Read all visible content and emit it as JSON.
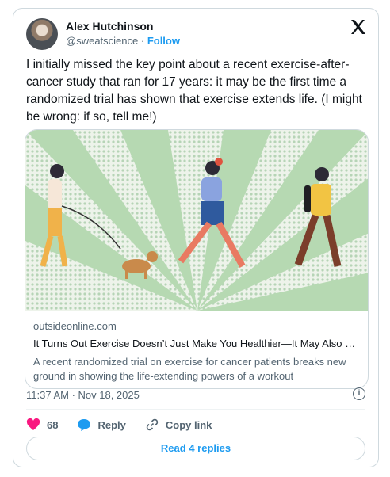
{
  "author": {
    "name": "Alex Hutchinson",
    "handle": "@sweatscience",
    "separator": " · ",
    "follow_label": "Follow"
  },
  "tweet": {
    "text": "I initially missed the key point about a recent exercise-after-cancer study that ran for 17 years: it may be the first time a randomized trial has shown that exercise extends life. (I might be wrong: if so, tell me!)",
    "timestamp": "11:37 AM · Nov 18, 2025"
  },
  "link_card": {
    "domain": "outsideonline.com",
    "headline": "It Turns Out Exercise Doesn’t Just Make You Healthier—It May Also H...",
    "description": "A recent randomized trial on exercise for cancer patients breaks new ground in showing the life-extending powers of a workout"
  },
  "actions": {
    "like_count": "68",
    "reply_label": "Reply",
    "copy_link_label": "Copy link"
  },
  "read_replies_label": "Read 4 replies",
  "colors": {
    "accent": "#1d9bf0",
    "like": "#f91880",
    "illustration_green": "#b5d8b5",
    "illustration_bg": "#e9f1e4"
  },
  "icons": {
    "brand": "x-logo-icon",
    "like": "heart-icon",
    "reply": "speech-bubble-icon",
    "copy": "link-icon",
    "info": "info-icon"
  }
}
